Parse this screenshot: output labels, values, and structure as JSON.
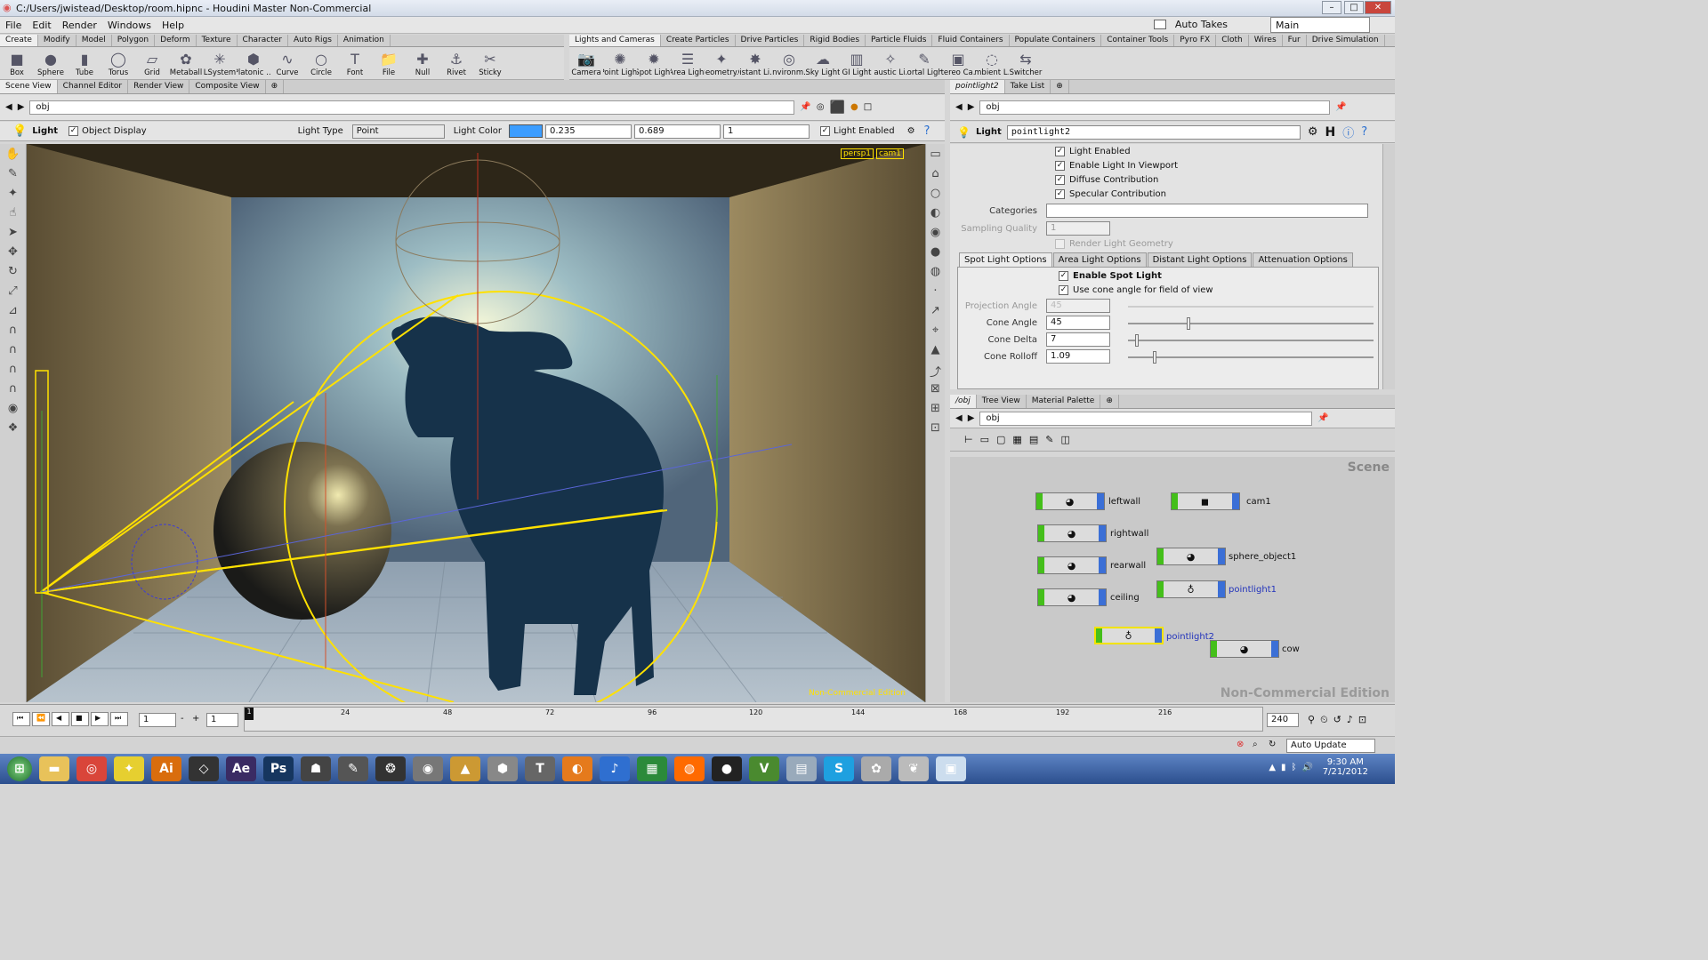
{
  "window": {
    "title": "C:/Users/jwistead/Desktop/room.hipnc - Houdini Master Non-Commercial",
    "auto_takes": "Auto Takes",
    "desktop": "Main"
  },
  "menu": [
    "File",
    "Edit",
    "Render",
    "Windows",
    "Help"
  ],
  "shelf_left": {
    "tabs": [
      "Create",
      "Modify",
      "Model",
      "Polygon",
      "Deform",
      "Texture",
      "Character",
      "Auto Rigs",
      "Animation"
    ],
    "tools": [
      "Box",
      "Sphere",
      "Tube",
      "Torus",
      "Grid",
      "Metaball",
      "LSystem",
      "Platonic ...",
      "Curve",
      "Circle",
      "Font",
      "File",
      "Null",
      "Rivet",
      "Sticky"
    ]
  },
  "shelf_right": {
    "tabs": [
      "Lights and Cameras",
      "Create Particles",
      "Drive Particles",
      "Rigid Bodies",
      "Particle Fluids",
      "Fluid Containers",
      "Populate Containers",
      "Container Tools",
      "Pyro FX",
      "Cloth",
      "Wires",
      "Fur",
      "Drive Simulation"
    ],
    "tools": [
      "Camera",
      "Point Light",
      "Spot Light",
      "Area Light",
      "Geometry...",
      "Distant Li...",
      "Environm...",
      "Sky Light",
      "GI Light",
      "Caustic Li...",
      "Portal Light",
      "Stereo Ca...",
      "Ambient L...",
      "Switcher"
    ]
  },
  "viewer": {
    "tabs": [
      "Scene View",
      "Channel Editor",
      "Render View",
      "Composite View"
    ],
    "path": "obj",
    "light_label": "Light",
    "object_display": "Object Display",
    "light_type_label": "Light Type",
    "light_type": "Point",
    "light_color_label": "Light Color",
    "color_r": "0.235",
    "color_g": "0.689",
    "color_b": "1",
    "light_enabled": "Light Enabled",
    "persp": "persp1",
    "cam": "cam1",
    "watermark": "Non-Commercial Edition"
  },
  "params": {
    "tabs": [
      "pointlight2",
      "Take List"
    ],
    "path": "obj",
    "light_label": "Light",
    "node_name": "pointlight2",
    "checks": [
      "Light Enabled",
      "Enable Light In Viewport",
      "Diffuse Contribution",
      "Specular Contribution"
    ],
    "categories": "Categories",
    "sampling_quality": "Sampling Quality",
    "sampling_value": "1",
    "render_geo": "Render Light Geometry",
    "subtabs": [
      "Spot Light Options",
      "Area Light Options",
      "Distant Light Options",
      "Attenuation Options"
    ],
    "enable_spot": "Enable Spot Light",
    "use_cone": "Use cone angle for field of view",
    "projection_angle": "Projection Angle",
    "projection_value": "45",
    "cone_angle": "Cone Angle",
    "cone_angle_value": "45",
    "cone_delta": "Cone Delta",
    "cone_delta_value": "7",
    "cone_rolloff": "Cone Rolloff",
    "cone_rolloff_value": "1.09"
  },
  "network": {
    "tabs": [
      "/obj",
      "Tree View",
      "Material Palette"
    ],
    "path": "obj",
    "scene_label": "Scene",
    "watermark": "Non-Commercial Edition",
    "nodes": [
      "leftwall",
      "rightwall",
      "rearwall",
      "ceiling",
      "cam1",
      "sphere_object1",
      "pointlight1",
      "pointlight2",
      "cow"
    ]
  },
  "timeline": {
    "frame": "1",
    "step": "1",
    "ticks": [
      "24",
      "48",
      "72",
      "96",
      "120",
      "144",
      "168",
      "192",
      "216"
    ],
    "end": "240",
    "auto_update": "Auto Update"
  },
  "taskbar": {
    "time": "9:30 AM",
    "date": "7/21/2012"
  }
}
